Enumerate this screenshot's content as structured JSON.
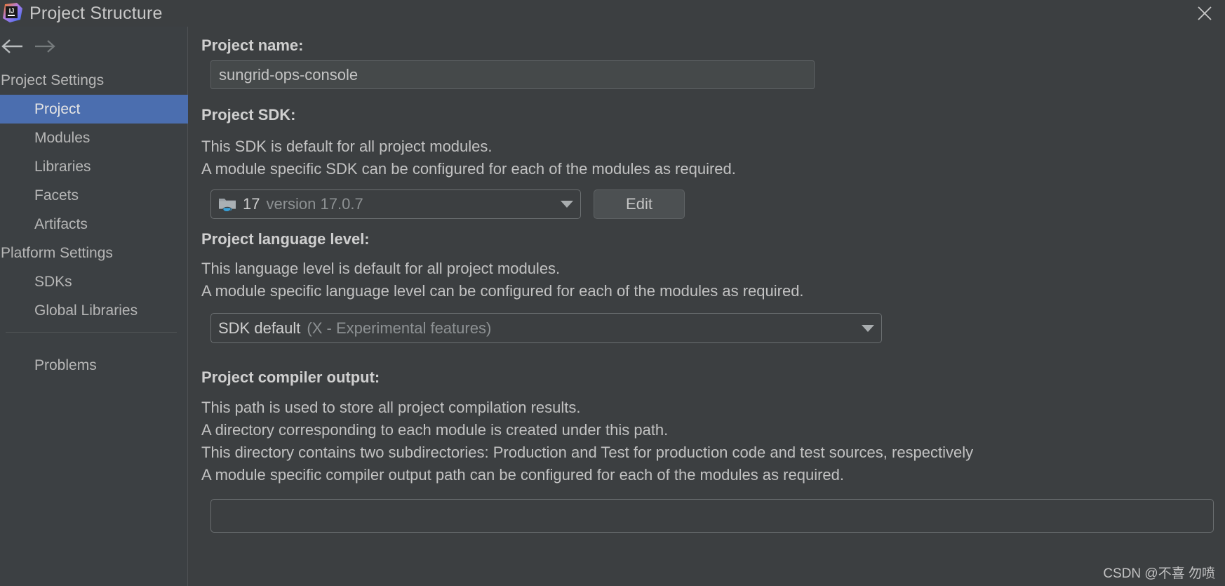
{
  "window": {
    "title": "Project Structure",
    "logo_text": "IJ",
    "close_icon": "close-icon",
    "back_icon": "arrow-left-icon",
    "forward_icon": "arrow-right-icon"
  },
  "sidebar": {
    "groups": [
      {
        "label": "Project Settings"
      },
      {
        "label": "Platform Settings"
      }
    ],
    "items": [
      {
        "label": "Project",
        "selected": true
      },
      {
        "label": "Modules",
        "selected": false
      },
      {
        "label": "Libraries",
        "selected": false
      },
      {
        "label": "Facets",
        "selected": false
      },
      {
        "label": "Artifacts",
        "selected": false
      },
      {
        "label": "SDKs",
        "selected": false
      },
      {
        "label": "Global Libraries",
        "selected": false
      },
      {
        "label": "Problems",
        "selected": false
      }
    ]
  },
  "main": {
    "project_name": {
      "label": "Project name:",
      "value": "sungrid-ops-console",
      "placeholder": ""
    },
    "project_sdk": {
      "label": "Project SDK:",
      "description_line_1": "This SDK is default for all project modules.",
      "description_line_2": "A module specific SDK can be configured for each of the modules as required.",
      "selected_name": "17",
      "selected_version": "version 17.0.7",
      "icon": "java-sdk-folder-icon",
      "edit_button": "Edit"
    },
    "language_level": {
      "label": "Project language level:",
      "description_line_1": "This language level is default for all project modules.",
      "description_line_2": "A module specific language level can be configured for each of the modules as required.",
      "selected_name": "SDK default",
      "selected_note": "(X - Experimental features)"
    },
    "compiler_output": {
      "label": "Project compiler output:",
      "description_line_1": "This path is used to store all project compilation results.",
      "description_line_2": "A directory corresponding to each module is created under this path.",
      "description_line_3": "This directory contains two subdirectories: Production and Test for production code and test sources, respectively",
      "description_line_4": "A module specific compiler output path can be configured for each of the modules as required.",
      "value": "",
      "placeholder": ""
    }
  },
  "watermark": {
    "text": "CSDN @不喜 勿喷"
  },
  "colors": {
    "background": "#3c3f41",
    "sidebar": "#3c4043",
    "selection": "#4b6eaf",
    "text": "#bbbbbb",
    "dim_text": "#8d9193",
    "field_bg": "#45494a",
    "button_bg": "#4c5052"
  }
}
